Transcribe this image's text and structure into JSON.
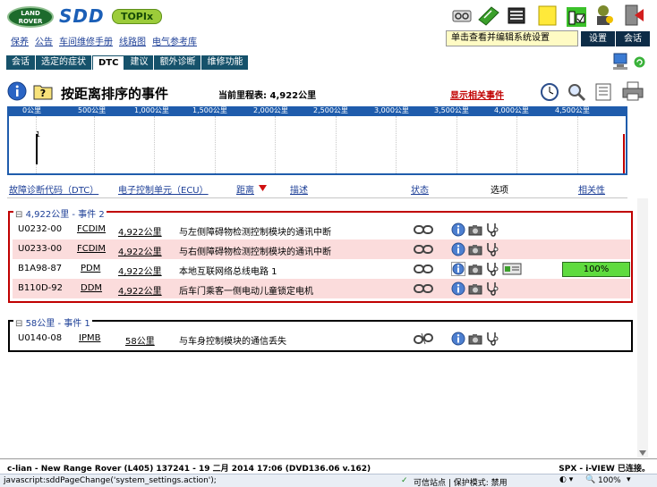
{
  "header": {
    "logo_landrover": "LAND ROVER",
    "logo_sdd": "SDD",
    "logo_topix": "TOPIx",
    "links": [
      "保养",
      "公告",
      "车间维修手册",
      "线路图",
      "电气参考库"
    ],
    "tooltip": "单击查看并编辑系统设置",
    "settings_label": "设置",
    "session_label": "会话"
  },
  "tabs": [
    {
      "label": "会话",
      "active": false
    },
    {
      "label": "选定的症状",
      "active": false
    },
    {
      "label": "DTC",
      "active": true
    },
    {
      "label": "建议",
      "active": false
    },
    {
      "label": "额外诊断",
      "active": false
    },
    {
      "label": "维修功能",
      "active": false
    }
  ],
  "title": {
    "text": "按距离排序的事件",
    "odometer_label": "当前里程表: 4,922公里",
    "related_link": "显示相关事件"
  },
  "timeline": {
    "tick_labels": [
      "0公里",
      "500公里",
      "1,000公里",
      "1,500公里",
      "2,000公里",
      "2,500公里",
      "3,000公里",
      "3,500公里",
      "4,000公里",
      "4,500公里"
    ],
    "marker_label": "1"
  },
  "columns": {
    "dtc": "故障诊断代码（DTC）",
    "ecu": "电子控制单元（ECU）",
    "distance": "距离",
    "description": "描述",
    "status": "状态",
    "options": "选项",
    "relevance": "相关性"
  },
  "groups": [
    {
      "label": "4,922公里 - 事件 2",
      "rows": [
        {
          "dtc": "U0232-00",
          "ecu": "FCDIM",
          "distance": "4,922公里",
          "description": "与左侧障碍物检测控制模块的通讯中断",
          "relevance": ""
        },
        {
          "dtc": "U0233-00",
          "ecu": "FCDIM",
          "distance": "4,922公里",
          "description": "与右侧障碍物检测控制模块的通讯中断",
          "relevance": ""
        },
        {
          "dtc": "B1A98-87",
          "ecu": "PDM",
          "distance": "4,922公里",
          "description": "本地互联网络总线电路 1",
          "relevance": "100%"
        },
        {
          "dtc": "B110D-92",
          "ecu": "DDM",
          "distance": "4,922公里",
          "description": "后车门乘客一侧电动儿童锁定电机",
          "relevance": ""
        }
      ]
    },
    {
      "label": "58公里 - 事件 1",
      "rows": [
        {
          "dtc": "U0140-08",
          "ecu": "IPMB",
          "distance": "58公里",
          "description": "与车身控制模块的通信丢失",
          "relevance": ""
        }
      ]
    }
  ],
  "footer": {
    "vehicle_info": "c-lian - New Range Rover (L405) 137241 - 19 二月 2014 17:06 (DVD136.06 v.162)",
    "connection": "SPX - i-VIEW 已连接。",
    "status_url": "javascript:sddPageChange('system_settings.action');",
    "trusted_site": "可信站点 | 保护模式: 禁用",
    "zoom": "100%"
  },
  "colors": {
    "nav_dark": "#16526b",
    "timeline_blue": "#1f5cac",
    "group_red": "#c00000",
    "row_pink": "#fbdcdc",
    "relevance_green": "#5fdb3f"
  }
}
